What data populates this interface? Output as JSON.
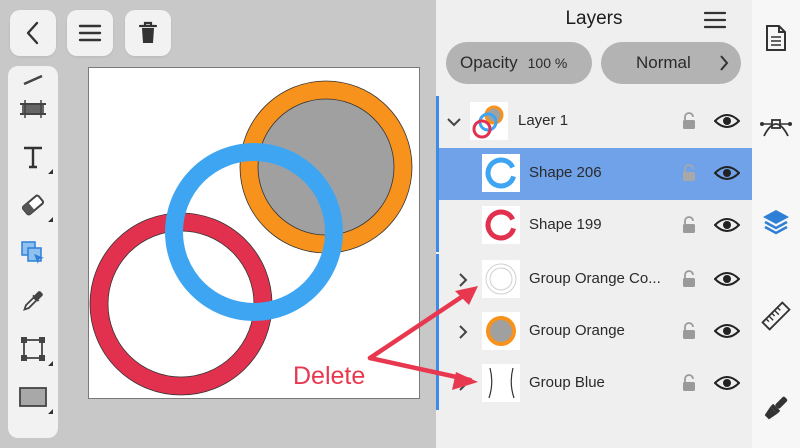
{
  "panel": {
    "title": "Layers",
    "opacity_label": "Opacity",
    "opacity_value": "100 %",
    "blend_mode": "Normal"
  },
  "layers": [
    {
      "label": "Layer 1"
    },
    {
      "label": "Shape 206"
    },
    {
      "label": "Shape 199"
    },
    {
      "label": "Group Orange Co..."
    },
    {
      "label": "Group Orange"
    },
    {
      "label": "Group Blue"
    }
  ],
  "annotation": {
    "text": "Delete"
  },
  "colors": {
    "accent": "#3d8ae8",
    "selected_row": "#6fa2e8",
    "red_ring": "#e2314f",
    "blue_ring": "#3ea5f2",
    "orange_ring": "#f7921c",
    "annotation_red": "#e8384f"
  },
  "icons": {
    "back": "chevron-left-icon",
    "menu": "hamburger-icon",
    "delete": "trash-icon",
    "document": "document-icon",
    "node": "node-tool-icon",
    "layers": "layers-icon",
    "ruler": "ruler-icon",
    "brush": "brush-icon"
  }
}
